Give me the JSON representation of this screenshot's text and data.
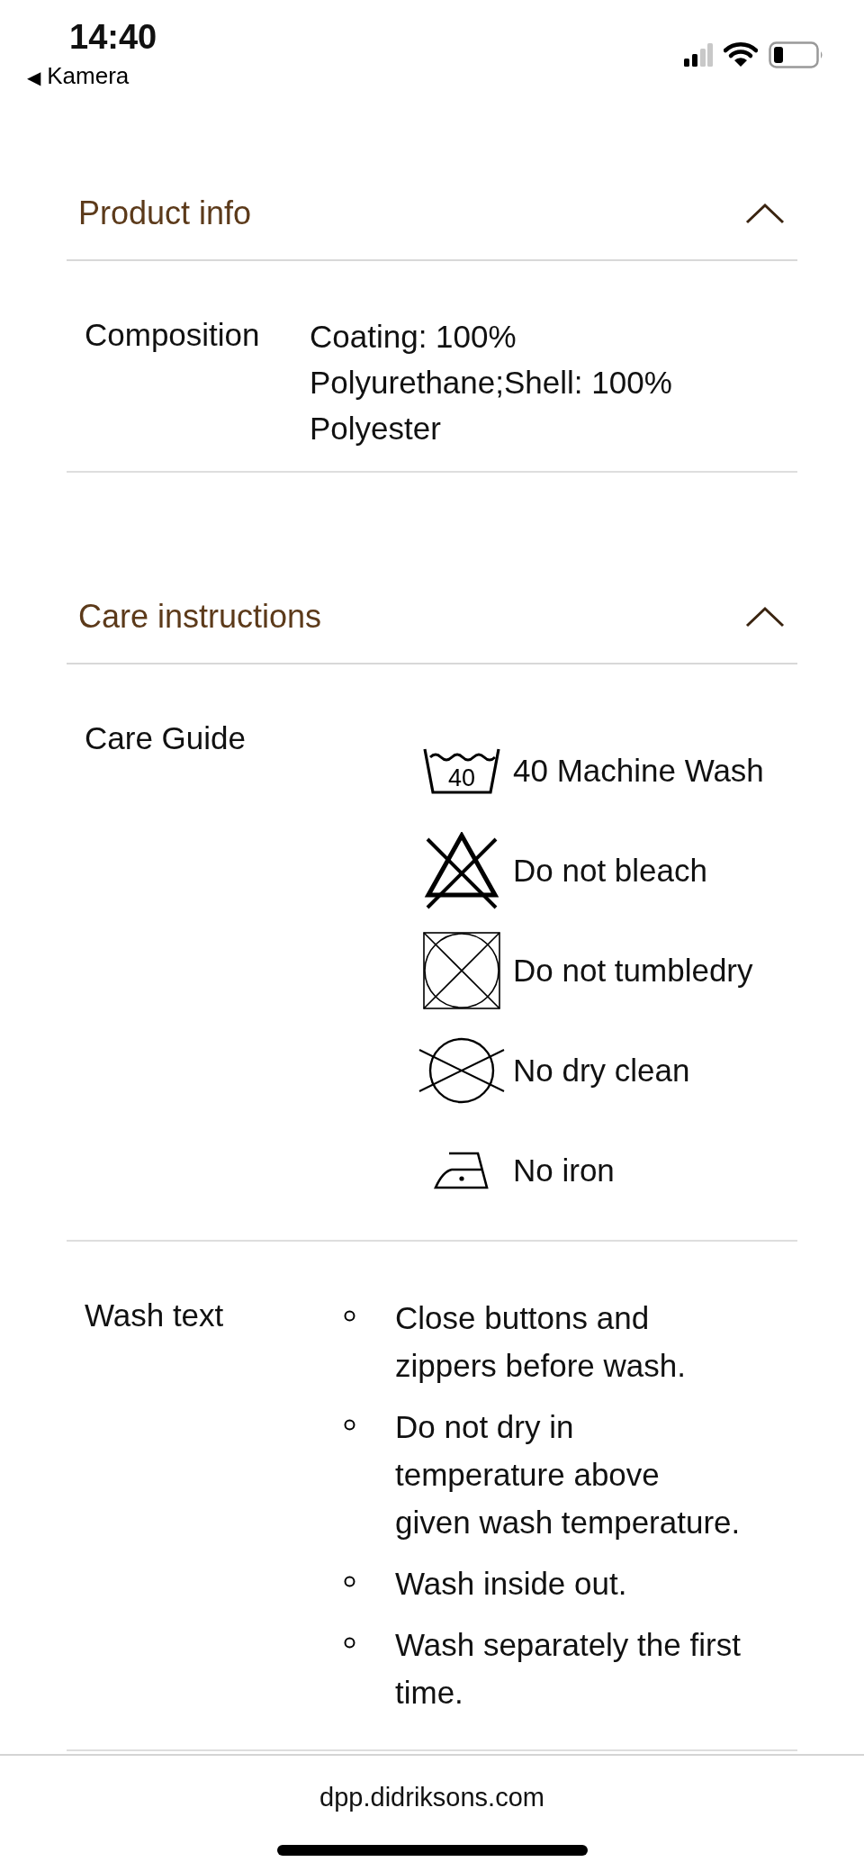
{
  "status_bar": {
    "time": "14:40",
    "back_label": "Kamera",
    "back_icon": "◀"
  },
  "sections": [
    {
      "title": "Product info",
      "expanded": true,
      "rows": [
        {
          "kind": "text",
          "label": "Composition",
          "value": "Coating: 100% Polyurethane;Shell: 100% Polyester"
        }
      ]
    },
    {
      "title": "Care instructions",
      "expanded": true,
      "rows": [
        {
          "kind": "care",
          "label": "Care Guide",
          "items": [
            {
              "kind": "wash",
              "temperature": "40",
              "text": "40 Machine Wash"
            },
            {
              "kind": "no_bleach",
              "text": "Do not bleach"
            },
            {
              "kind": "no_tumble_dry",
              "text": "Do not tumbledry"
            },
            {
              "kind": "no_dry_clean",
              "text": "No dry clean"
            },
            {
              "kind": "iron",
              "text": "No iron"
            }
          ]
        },
        {
          "kind": "list",
          "label": "Wash text",
          "items": [
            "Close buttons and zippers before wash.",
            "Do not dry in temperature above given wash temperature.",
            "Wash inside out.",
            "Wash separately the first time."
          ]
        }
      ]
    }
  ],
  "address_bar": {
    "url": "dpp.didriksons.com"
  }
}
